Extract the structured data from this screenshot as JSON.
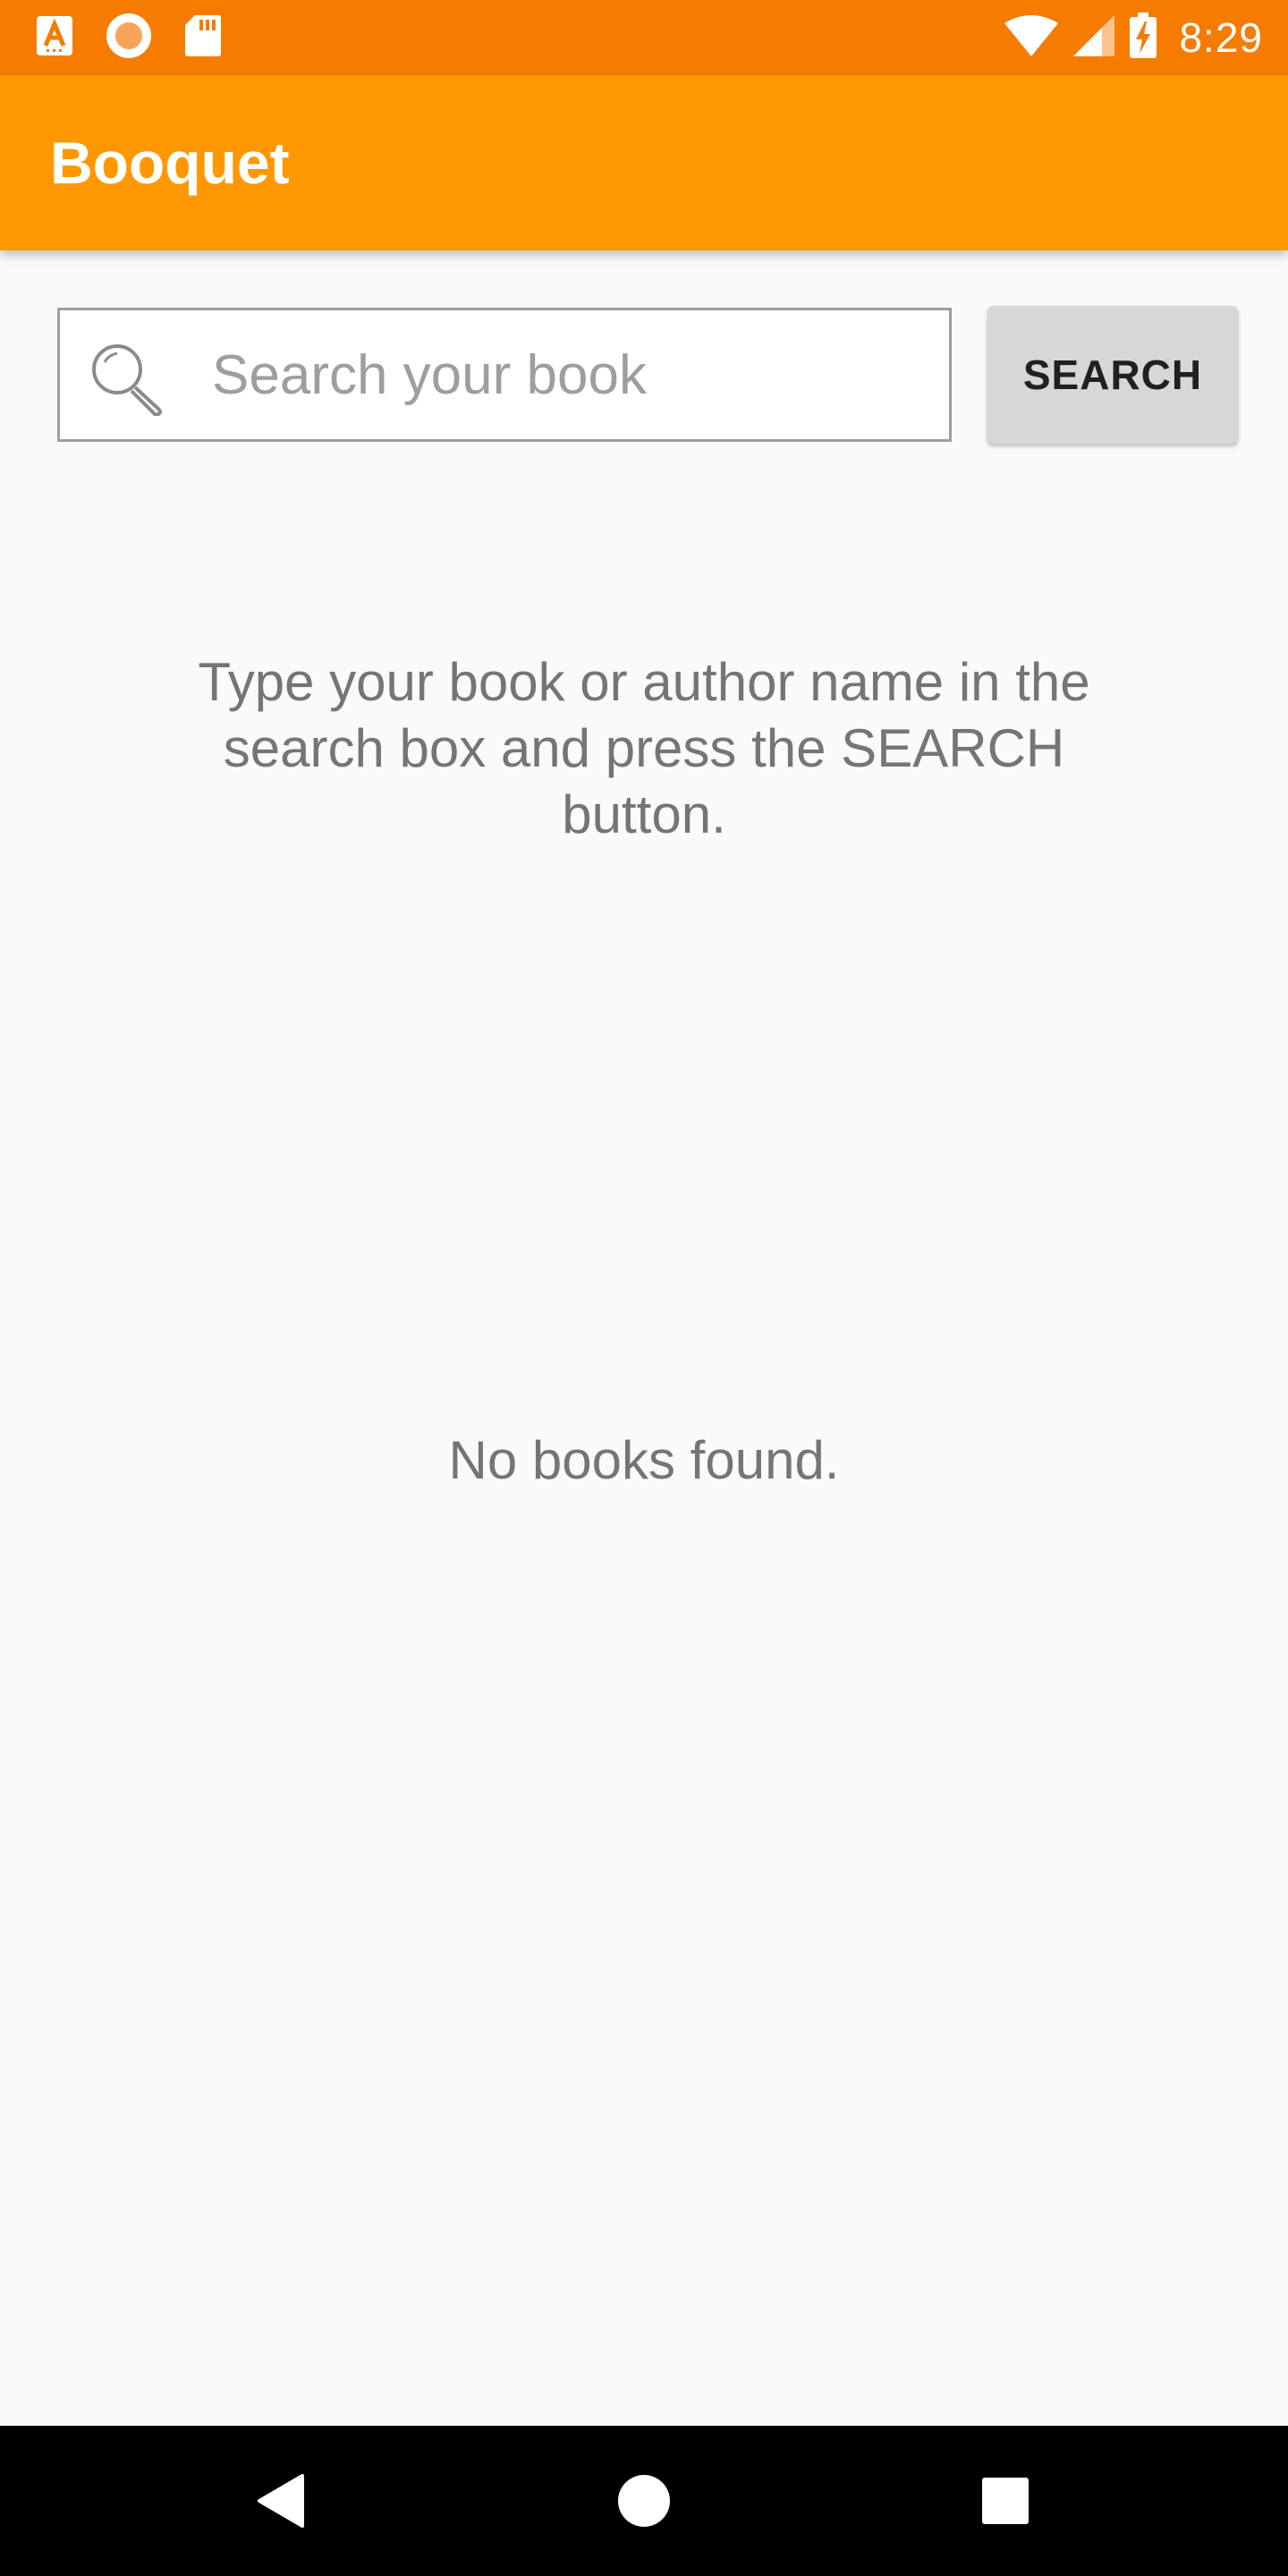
{
  "status_bar": {
    "time": "8:29",
    "icons": [
      "a-notification-icon",
      "circle-notification-icon",
      "sd-card-icon",
      "wifi-icon",
      "cell-signal-icon",
      "battery-charging-icon"
    ]
  },
  "app_bar": {
    "title": "Booquet"
  },
  "search": {
    "placeholder": "Search your book",
    "value": "",
    "button_label": "SEARCH"
  },
  "content": {
    "instruction": "Type your book or author name in the search box and press the SEARCH button.",
    "empty_message": "No books found."
  },
  "nav_bar": {
    "buttons": [
      "back-icon",
      "home-icon",
      "recents-icon"
    ]
  },
  "colors": {
    "status_bar": "#f57c00",
    "app_bar": "#ff9800",
    "background": "#fafafa",
    "button": "#d6d7d7",
    "body_text": "#757575"
  }
}
